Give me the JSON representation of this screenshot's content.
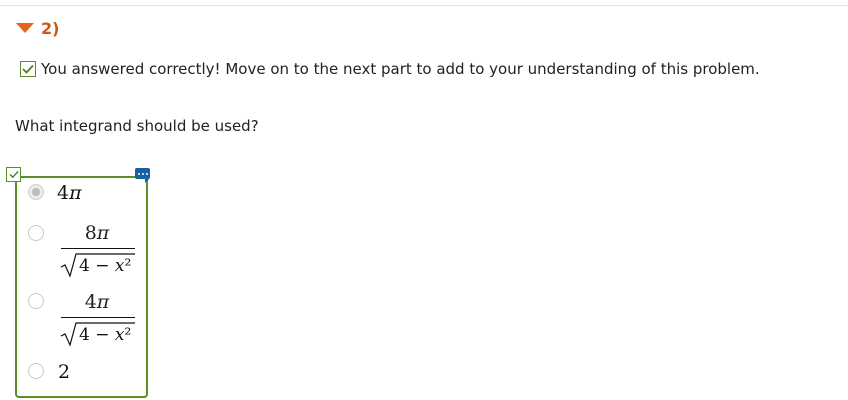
{
  "part": {
    "number": "2)"
  },
  "feedback": {
    "text": "You answered correctly! Move on to the next part to add to your understanding of this problem."
  },
  "question": {
    "text": "What integrand should be used?"
  },
  "options": [
    {
      "label": "4π",
      "selected": true
    },
    {
      "numerator": "8π",
      "denominator_radicand": "4 − x²",
      "selected": false
    },
    {
      "numerator": "4π",
      "denominator_radicand": "4 − x²",
      "selected": false
    },
    {
      "label": "2",
      "selected": false
    }
  ],
  "colors": {
    "accent": "#e8621a",
    "correct": "#5b8f27",
    "comment": "#1a5f9e"
  },
  "icons": {
    "toggle": "triangle-down-icon",
    "check": "check-icon",
    "comment": "comment-icon"
  }
}
